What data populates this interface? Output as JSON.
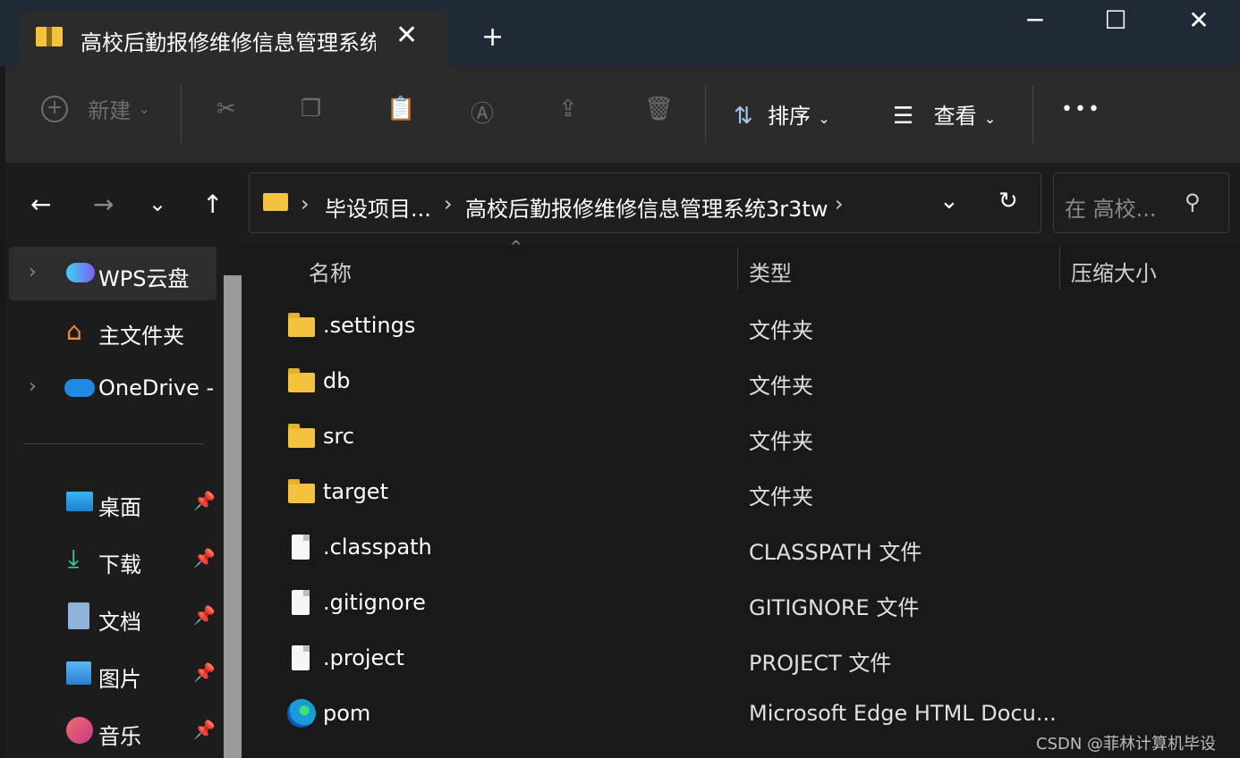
{
  "window": {
    "tab_title": "高校后勤报修维修信息管理系统",
    "close_tab_glyph": "✕",
    "new_tab_glyph": "+",
    "minimize_glyph": "─",
    "maximize_glyph": "☐",
    "close_glyph": "✕"
  },
  "toolbar": {
    "new_label": "新建",
    "sort_label": "排序",
    "view_label": "查看",
    "more_glyph": "•••",
    "icons": [
      "cut-icon",
      "copy-icon",
      "paste-icon",
      "rename-icon",
      "share-icon",
      "delete-icon"
    ]
  },
  "address": {
    "crumbs": [
      "毕设项目...",
      "高校后勤报修维修信息管理系统3r3tw"
    ],
    "search_placeholder": "在 高校..."
  },
  "sidebar": {
    "items": [
      {
        "label": "WPS云盘"
      },
      {
        "label": "主文件夹"
      },
      {
        "label": "OneDrive -"
      },
      {
        "label": "桌面"
      },
      {
        "label": "下载"
      },
      {
        "label": "文档"
      },
      {
        "label": "图片"
      },
      {
        "label": "音乐"
      }
    ]
  },
  "columns": {
    "name": "名称",
    "type": "类型",
    "size": "压缩大小"
  },
  "files": [
    {
      "name": ".settings",
      "type": "文件夹",
      "icon": "folder-icon"
    },
    {
      "name": "db",
      "type": "文件夹",
      "icon": "folder-icon"
    },
    {
      "name": "src",
      "type": "文件夹",
      "icon": "folder-icon"
    },
    {
      "name": "target",
      "type": "文件夹",
      "icon": "folder-icon"
    },
    {
      "name": ".classpath",
      "type": "CLASSPATH 文件",
      "icon": "file-icon"
    },
    {
      "name": ".gitignore",
      "type": "GITIGNORE 文件",
      "icon": "file-icon"
    },
    {
      "name": ".project",
      "type": "PROJECT 文件",
      "icon": "file-icon"
    },
    {
      "name": "pom",
      "type": "Microsoft Edge HTML Docu...",
      "icon": "edge-icon"
    }
  ],
  "watermark": "CSDN @菲林计算机毕设",
  "colors": {
    "background": "#191919",
    "titlebar": "#1f2a36",
    "folder": "#f3c33f"
  }
}
